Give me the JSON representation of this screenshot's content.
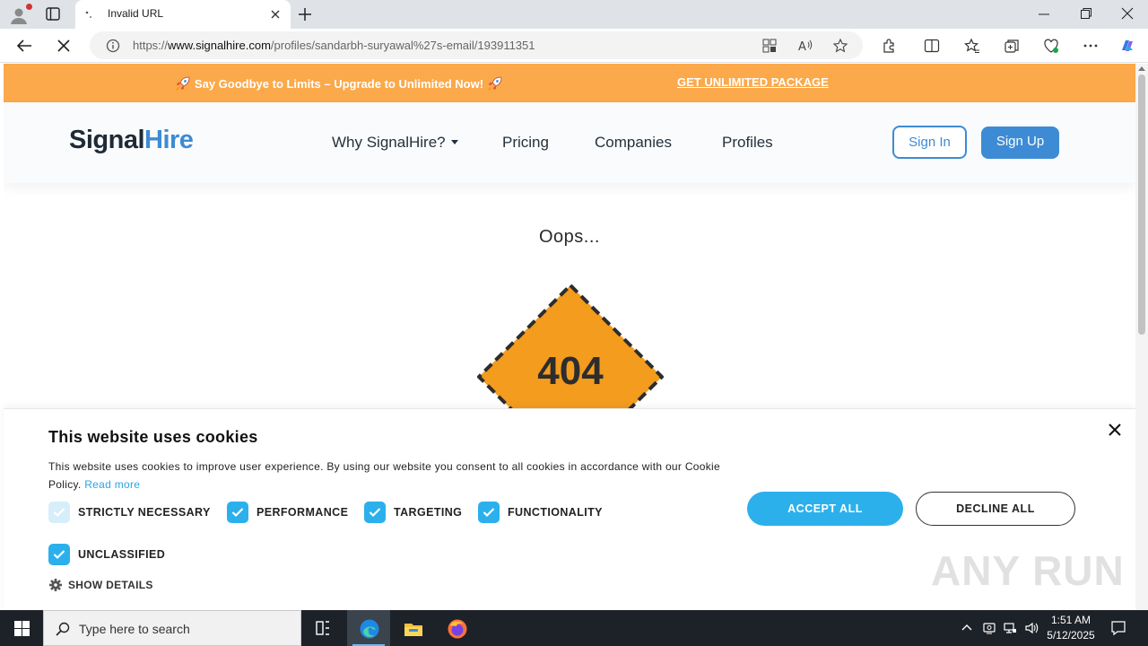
{
  "browser": {
    "tab_title": "Invalid URL",
    "url_domain_prefix": "https://",
    "url_domain": "www.signalhire.com",
    "url_path": "/profiles/sandarbh-suryawal%27s-email/193911351"
  },
  "promo": {
    "text": "Say Goodbye to Limits – Upgrade to Unlimited Now!",
    "link": "GET UNLIMITED PACKAGE",
    "color": "#fba94a"
  },
  "nav": {
    "logo_part1": "Signal",
    "logo_part2": "Hire",
    "items": [
      "Why SignalHire?",
      "Pricing",
      "Companies",
      "Profiles"
    ],
    "sign_in": "Sign In",
    "sign_up": "Sign Up",
    "accent": "#3d8bd4"
  },
  "error": {
    "heading": "Oops...",
    "code": "404",
    "badge_color": "#f39c1e"
  },
  "cookie": {
    "title": "This website uses cookies",
    "description": "This website uses cookies to improve user experience. By using our website you consent to all cookies in accordance with our Cookie Policy.",
    "read_more": "Read more",
    "options": [
      {
        "label": "STRICTLY NECESSARY",
        "checked": true,
        "disabled": true
      },
      {
        "label": "PERFORMANCE",
        "checked": true,
        "disabled": false
      },
      {
        "label": "TARGETING",
        "checked": true,
        "disabled": false
      },
      {
        "label": "FUNCTIONALITY",
        "checked": true,
        "disabled": false
      },
      {
        "label": "UNCLASSIFIED",
        "checked": true,
        "disabled": false
      }
    ],
    "show_details": "SHOW DETAILS",
    "accept_all": "ACCEPT ALL",
    "decline_all": "DECLINE ALL",
    "accent": "#2bb0ec"
  },
  "watermark": "ANY RUN",
  "taskbar": {
    "search_placeholder": "Type here to search",
    "time": "1:51 AM",
    "date": "5/12/2025"
  }
}
